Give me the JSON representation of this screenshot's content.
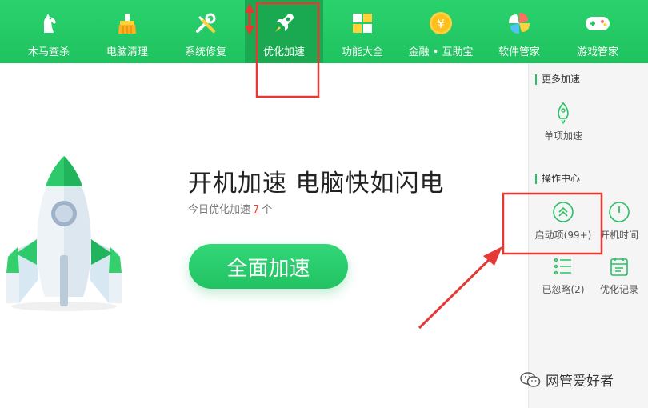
{
  "nav": {
    "items": [
      {
        "label": "木马查杀",
        "icon": "horse-icon"
      },
      {
        "label": "电脑清理",
        "icon": "broom-icon"
      },
      {
        "label": "系统修复",
        "icon": "wrench-screwdriver-icon"
      },
      {
        "label": "优化加速",
        "icon": "rocket-icon",
        "active": true
      },
      {
        "label": "功能大全",
        "icon": "grid-icon"
      },
      {
        "label": "金融 • 互助宝",
        "icon": "yuan-coin-icon"
      },
      {
        "label": "软件管家",
        "icon": "pinwheel-icon"
      },
      {
        "label": "游戏管家",
        "icon": "gamepad-icon"
      }
    ]
  },
  "main": {
    "headline": "开机加速 电脑快如闪电",
    "today_prefix": "今日优化加速",
    "today_count": "7",
    "today_suffix": "个",
    "speed_button": "全面加速",
    "illustration_icon": "rocket-illustration"
  },
  "side": {
    "more_title": "更多加速",
    "single_label": "单项加速",
    "ops_title": "操作中心",
    "startup_label": "启动项(99+)",
    "boot_time_label": "开机时间",
    "ignored_label": "已忽略(2)",
    "history_label": "优化记录"
  },
  "watermark": {
    "text": "网管爱好者",
    "icon": "wechat-icon"
  },
  "colors": {
    "nav_green": "#22c762",
    "accent_green": "#25c365",
    "annotation_red": "#e53935",
    "count_red": "#e2473a"
  }
}
